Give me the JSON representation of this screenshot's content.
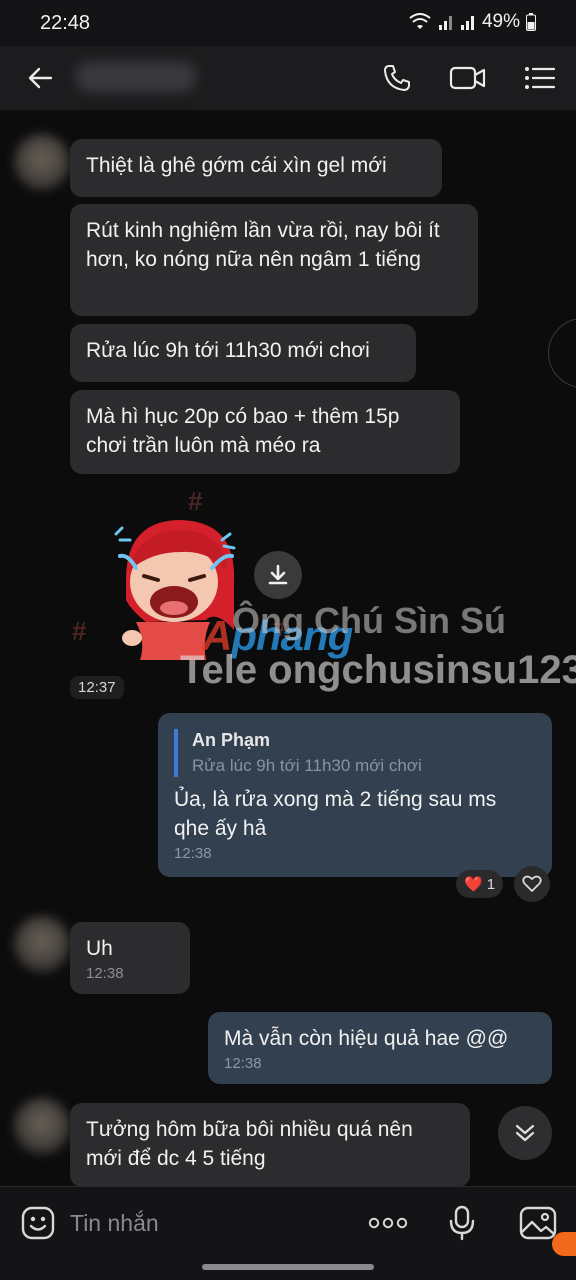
{
  "status_bar": {
    "time": "22:48",
    "battery": "49%"
  },
  "header": {
    "back_icon": "arrow-left-icon",
    "call_icon": "phone-icon",
    "video_icon": "video-camera-icon",
    "menu_icon": "menu-list-icon"
  },
  "messages": [
    {
      "text": "Thiệt là ghê gớm cái xìn gel mới"
    },
    {
      "text": "Rút kinh nghiệm lần vừa rồi, nay bôi ít hơn, ko nóng nữa nên ngâm 1 tiếng"
    },
    {
      "text": "Rửa lúc 9h tới 11h30 mới chơi"
    },
    {
      "text": "Mà hì hục 20p có bao + thêm 15p chơi trần luôn mà méo ra"
    }
  ],
  "sticker": {
    "time": "12:37",
    "download_icon": "download-icon"
  },
  "watermark": {
    "line1": "Ông Chú Sìn Sú",
    "line2": "Tele ongchusinsu123",
    "logo_a": "A",
    "logo_rest": "phang"
  },
  "reply": {
    "quote_name": "An Phạm",
    "quote_text": "Rửa lúc 9h tới 11h30 mới chơi",
    "text": "Ủa, là rửa xong mà 2 tiếng sau ms qhe ấy hả",
    "time": "12:38",
    "reaction": "❤️",
    "reaction_count": "1"
  },
  "uh": {
    "text": "Uh",
    "time": "12:38"
  },
  "out2": {
    "text": "Mà vẫn còn hiệu quả hae @@",
    "time": "12:38"
  },
  "last": {
    "text": "Tưởng hôm bữa bôi nhiều quá nên mới để dc 4 5 tiếng"
  },
  "input": {
    "placeholder": "Tin nhắn"
  },
  "colors": {
    "accent": "#3f7ad6",
    "outgoing_bubble": "#33404f",
    "incoming_bubble": "#2c2c2e"
  }
}
